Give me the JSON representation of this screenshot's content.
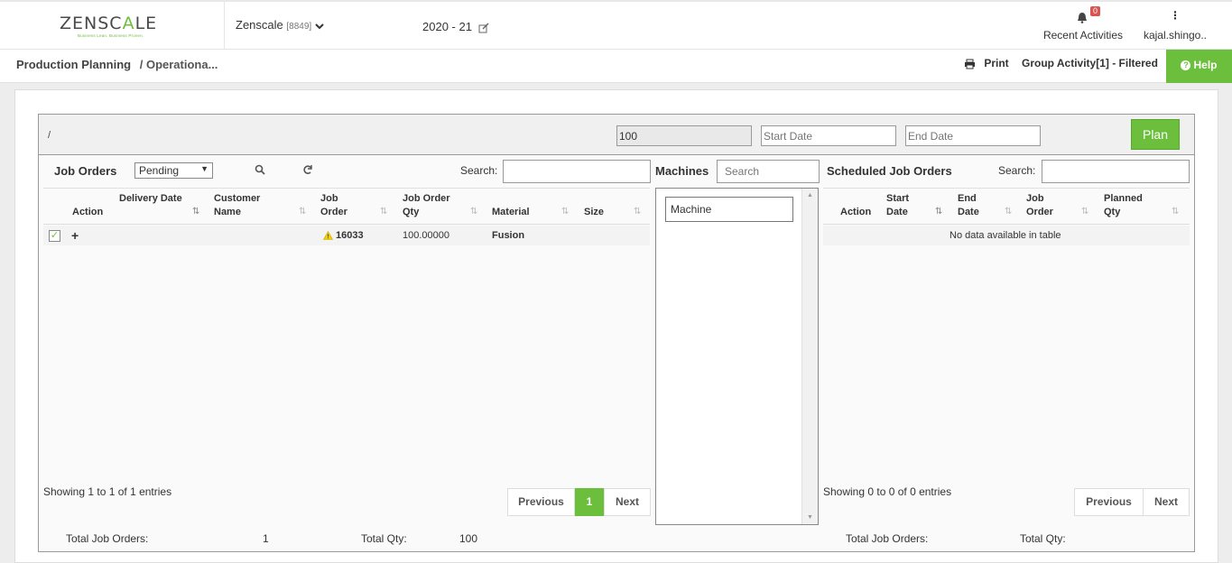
{
  "header": {
    "logo_text_a": "ZENSC",
    "logo_text_b": "A",
    "logo_text_c": "LE",
    "logo_tagline": "Business Lean. Business Proven.",
    "company": "Zenscale",
    "company_code": "[8849]",
    "year": "2020 - 21",
    "recent_activities": "Recent Activities",
    "notification_count": "0",
    "user": "kajal.shingo.."
  },
  "subbar": {
    "crumb_main": "Production Planning",
    "crumb_sub": "/ Operationa...",
    "print": "Print",
    "group_activity": "Group Activity[1] - Filtered",
    "help": "Help"
  },
  "controls": {
    "slash": "/",
    "qty_value": "100",
    "start_placeholder": "Start Date",
    "end_placeholder": "End Date",
    "plan": "Plan"
  },
  "job_orders": {
    "title": "Job Orders",
    "status": "Pending",
    "search_label": "Search:",
    "columns": [
      "Action",
      "Delivery Date",
      "Customer Name",
      "Job Order",
      "Job Order Qty",
      "Material",
      "Size"
    ],
    "rows": [
      {
        "delivery": "",
        "customer": "",
        "job_order": "16033",
        "qty": "100.00000",
        "material": "Fusion",
        "size": ""
      }
    ],
    "showing": "Showing 1 to 1 of 1 entries",
    "prev": "Previous",
    "page": "1",
    "next": "Next",
    "total_job_orders_label": "Total Job Orders:",
    "total_job_orders": "1",
    "total_qty_label": "Total Qty:",
    "total_qty": "100"
  },
  "machines": {
    "title": "Machines",
    "search_placeholder": "Search",
    "items": [
      "Machine"
    ]
  },
  "scheduled": {
    "title": "Scheduled Job Orders",
    "search_label": "Search:",
    "columns": [
      "Action",
      "Start Date",
      "End Date",
      "Job Order",
      "Planned Qty"
    ],
    "empty": "No data available in table",
    "showing": "Showing 0 to 0 of 0 entries",
    "prev": "Previous",
    "next": "Next",
    "total_job_orders_label": "Total Job Orders:",
    "total_qty_label": "Total Qty:"
  },
  "colors": {
    "accent": "#6cbf3c",
    "badge": "#d9534f",
    "warning": "#f0d000"
  }
}
